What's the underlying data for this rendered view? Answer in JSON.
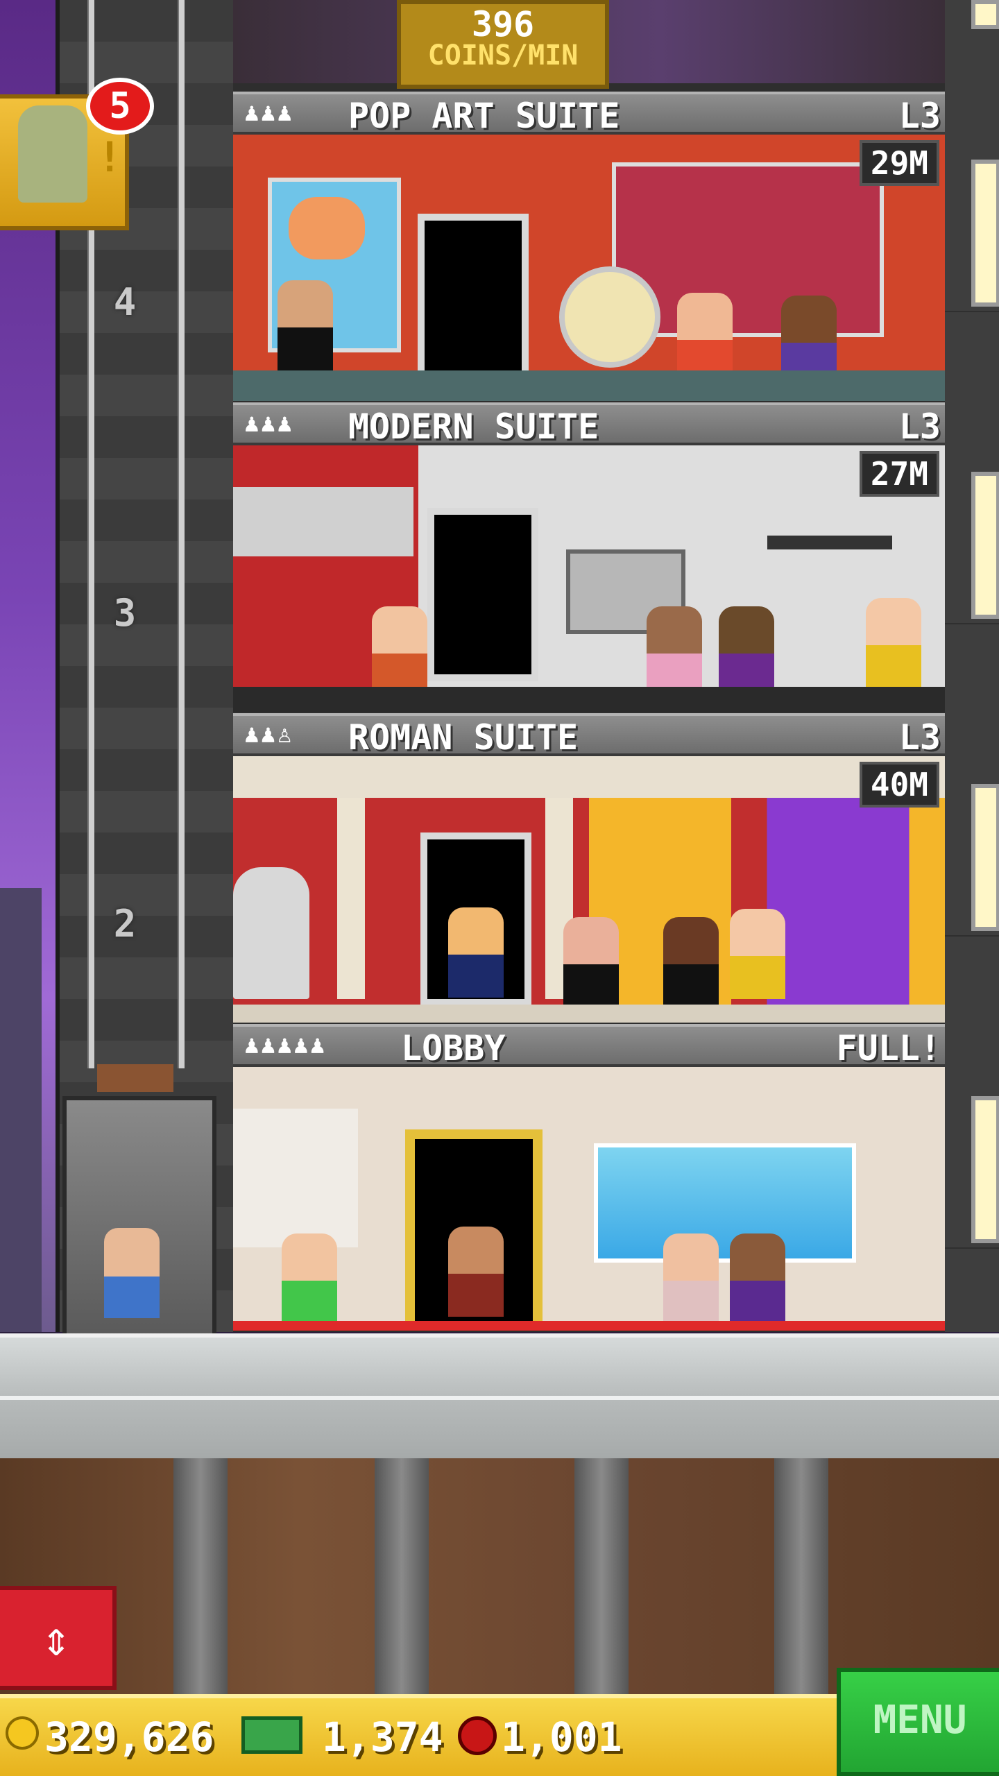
{
  "header": {
    "coins_rate_value": "396",
    "coins_rate_unit": "COINS/MIN"
  },
  "visitor": {
    "badge_count": "5",
    "alert": "!"
  },
  "elevator": {
    "floor_labels": [
      "4",
      "3",
      "2"
    ]
  },
  "floors": [
    {
      "name": "POP ART SUITE",
      "level": "L3",
      "timer": "29M",
      "occupants": "♟♟♟"
    },
    {
      "name": "MODERN SUITE",
      "level": "L3",
      "timer": "27M",
      "occupants": "♟♟♟"
    },
    {
      "name": "ROMAN SUITE",
      "level": "L3",
      "timer": "40M",
      "occupants": "♟♟♙"
    },
    {
      "name": "LOBBY",
      "level": "FULL!",
      "timer": "",
      "occupants": "♟♟♟♟♟"
    }
  ],
  "status_bar": {
    "coins": "329,626",
    "cash": "1,374",
    "bux": "1,001"
  },
  "buttons": {
    "menu": "MENU",
    "elevator_toggle": "⇕"
  },
  "colors": {
    "pop_art_wall": "#d0452a",
    "modern_wall": "#c9c9c9",
    "roman_wall": "#c12e2e",
    "lobby_wall": "#e8ddd0",
    "menu_green": "#2bbd3b",
    "bar_gold": "#f0c535"
  },
  "icons": {
    "coin": "coin-icon",
    "cash": "cash-icon",
    "bux": "bux-icon",
    "occupant": "person-icon"
  }
}
